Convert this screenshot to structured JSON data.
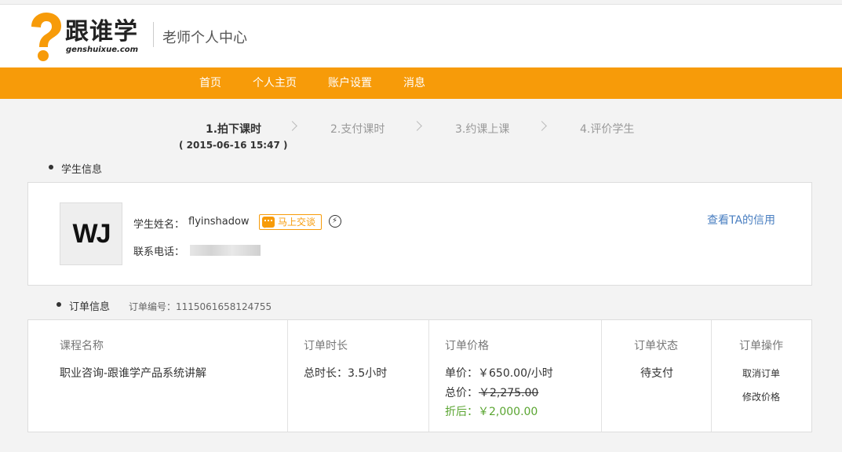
{
  "header": {
    "logo_cn": "跟谁学",
    "logo_en": "genshuixue.com",
    "title": "老师个人中心"
  },
  "nav": {
    "items": [
      {
        "label": "首页"
      },
      {
        "label": "个人主页"
      },
      {
        "label": "账户设置"
      },
      {
        "label": "消息"
      }
    ]
  },
  "steps": {
    "items": [
      {
        "label": "1.拍下课时"
      },
      {
        "label": "2.支付课时"
      },
      {
        "label": "3.约课上课"
      },
      {
        "label": "4.评价学生"
      }
    ],
    "date": "( 2015-06-16 15:47 )"
  },
  "student": {
    "section_label": "学生信息",
    "avatar_text": "WJ",
    "name_label": "学生姓名：",
    "name": "flyinshadow",
    "chat_label": "马上交谈",
    "phone_label": "联系电话：",
    "credit_link": "查看TA的信用"
  },
  "order": {
    "section_label": "订单信息",
    "order_id": "订单编号：1115061658124755",
    "columns": {
      "course": "课程名称",
      "duration": "订单时长",
      "price": "订单价格",
      "status": "订单状态",
      "actions": "订单操作"
    },
    "course_name": "职业咨询-跟谁学产品系统讲解",
    "duration": "总时长：3.5小时",
    "unit_price": "单价：￥650.00/小时",
    "total_label": "总价：",
    "total_value": "￥2,275.00",
    "discount": "折后：￥2,000.00",
    "status": "待支付",
    "cancel": "取消订单",
    "modify": "修改价格"
  },
  "colors": {
    "brand_orange": "#f79b09",
    "link_blue": "#4a7fc1",
    "discount_green": "#5aa531"
  }
}
